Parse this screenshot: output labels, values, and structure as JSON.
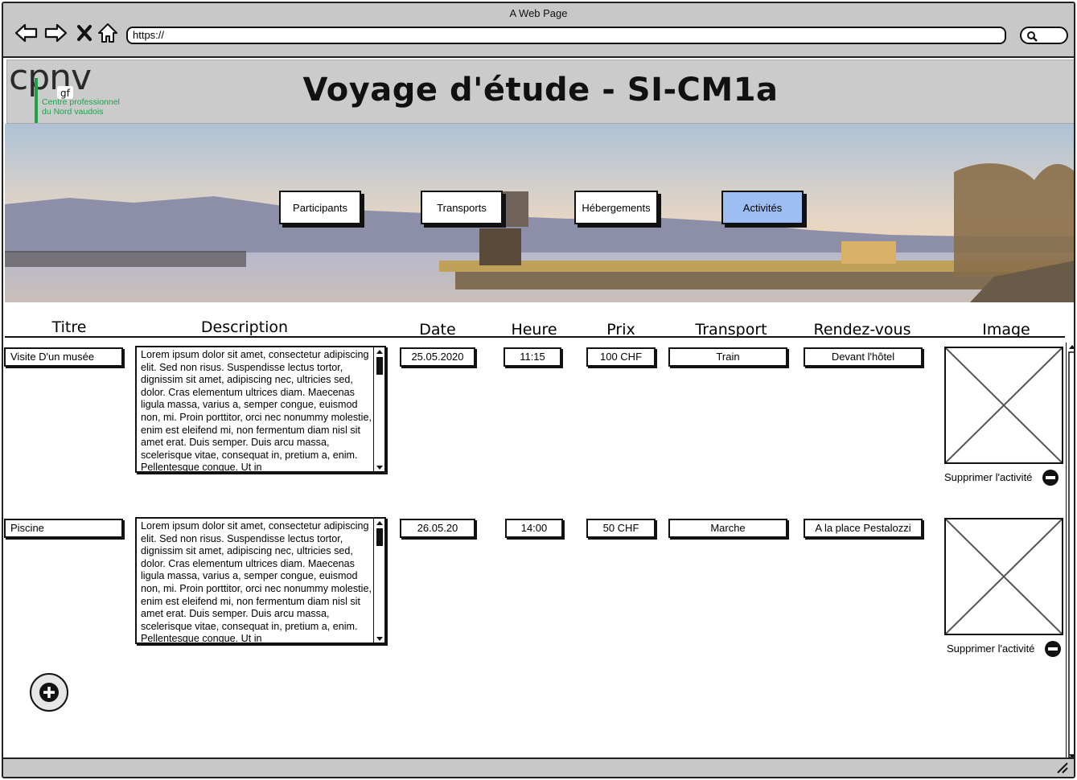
{
  "window": {
    "title": "A Web Page"
  },
  "browser": {
    "url": "https://"
  },
  "header": {
    "logo_text": "cpnv",
    "logo_badge": "gf",
    "logo_subtitle_1": "Centre professionnel",
    "logo_subtitle_2": "du Nord vaudois",
    "title": "Voyage d'étude - SI-CM1a"
  },
  "nav": {
    "participants": "Participants",
    "transports": "Transports",
    "hebergements": "Hébergements",
    "activites": "Activités",
    "active_tab": "Activités",
    "active_color": "#9ebdf2"
  },
  "table": {
    "headers": {
      "titre": "Titre",
      "description": "Description",
      "date": "Date",
      "heure": "Heure",
      "prix": "Prix",
      "transport": "Transport",
      "rendez_vous": "Rendez-vous",
      "image": "Image"
    },
    "rows": [
      {
        "titre": "Visite D'un musée",
        "description": "Lorem ipsum dolor sit amet, consectetur adipiscing elit. Sed non risus. Suspendisse lectus tortor, dignissim sit amet, adipiscing nec, ultricies sed, dolor. Cras elementum ultrices diam. Maecenas ligula massa, varius a, semper congue, euismod non, mi. Proin porttitor, orci nec nonummy molestie, enim est eleifend mi, non fermentum diam nisl sit amet erat. Duis semper. Duis arcu massa, scelerisque vitae, consequat in, pretium a, enim. Pellentesque congue. Ut in",
        "date": "25.05.2020",
        "heure": "11:15",
        "prix": "100 CHF",
        "transport": "Train",
        "rendez_vous": "Devant l'hôtel",
        "delete_label": "Supprimer l'activité"
      },
      {
        "titre": "Piscine",
        "description": "Lorem ipsum dolor sit amet, consectetur adipiscing elit. Sed non risus. Suspendisse lectus tortor, dignissim sit amet, adipiscing nec, ultricies sed, dolor. Cras elementum ultrices diam. Maecenas ligula massa, varius a, semper congue, euismod non, mi. Proin porttitor, orci nec nonummy molestie, enim est eleifend mi, non fermentum diam nisl sit amet erat. Duis semper. Duis arcu massa, scelerisque vitae, consequat in, pretium a, enim. Pellentesque congue. Ut in",
        "date": "26.05.20",
        "heure": "14:00",
        "prix": "50 CHF",
        "transport": "Marche",
        "rendez_vous": "A la place Pestalozzi",
        "delete_label": "Supprimer l'activité"
      }
    ]
  },
  "icons": {
    "back": "back-arrow-icon",
    "forward": "forward-arrow-icon",
    "stop": "close-icon",
    "home": "home-icon",
    "search": "search-icon",
    "add": "plus-circle-icon",
    "delete": "minus-circle-icon",
    "image": "image-placeholder-icon",
    "resize": "resize-grip-icon"
  }
}
